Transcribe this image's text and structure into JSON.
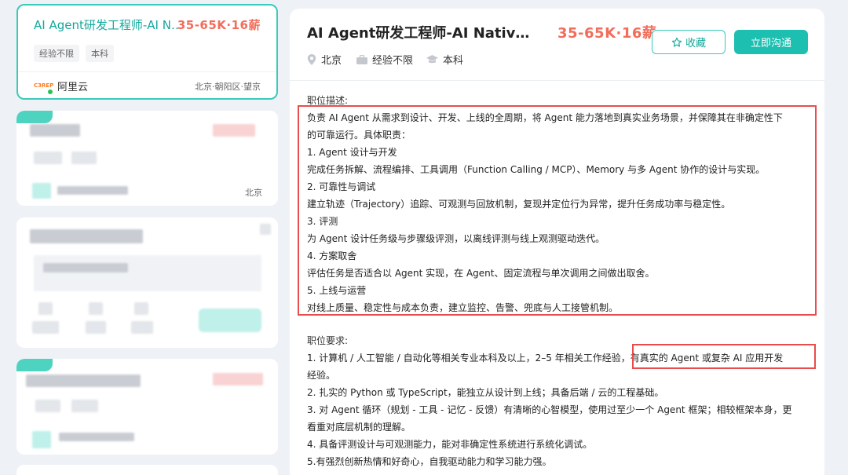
{
  "job_list": {
    "active_card": {
      "title": "AI Agent研发工程师-AI Native创新",
      "salary": "35-65K·16薪",
      "tags": [
        "经验不限",
        "本科"
      ],
      "company_logo_text": "C3REP",
      "company": "阿里云",
      "location": "北京·朝阳区·望京"
    },
    "card2": {
      "location": "北京"
    }
  },
  "detail": {
    "title": "AI Agent研发工程师-AI Native创新",
    "salary": "35-65K·16薪",
    "favorite_label": "收藏",
    "chat_label": "立即沟通",
    "meta": {
      "city": "北京",
      "experience": "经验不限",
      "education": "本科"
    },
    "description_heading": "职位描述:",
    "description_lines": [
      "负责 AI Agent 从需求到设计、开发、上线的全周期，将 Agent 能力落地到真实业务场景，并保障其在非确定性下",
      "的可靠运行。具体职责：",
      "1. Agent 设计与开发",
      "完成任务拆解、流程编排、工具调用（Function Calling / MCP）、Memory 与多 Agent 协作的设计与实现。",
      "2. 可靠性与调试",
      "建立轨迹（Trajectory）追踪、可观测与回放机制，复现并定位行为异常，提升任务成功率与稳定性。",
      "3. 评测",
      "为 Agent 设计任务级与步骤级评测，以离线评测与线上观测驱动迭代。",
      "4. 方案取舍",
      "评估任务是否适合以 Agent 实现，在 Agent、固定流程与单次调用之间做出取舍。",
      "5. 上线与运营",
      "对线上质量、稳定性与成本负责，建立监控、告警、兜底与人工接管机制。"
    ],
    "requirements_heading": "职位要求:",
    "requirement_lines": [
      "1. 计算机 / 人工智能 / 自动化等相关专业本科及以上，2–5 年相关工作经验，有真实的 Agent 或复杂 AI 应用开发",
      "经验。",
      "2. 扎实的 Python 或 TypeScript，能独立从设计到上线；具备后端 / 云的工程基础。",
      "3. 对 Agent 循环（规划 - 工具 - 记忆 - 反馈）有清晰的心智模型，使用过至少一个 Agent 框架；相较框架本身，更",
      "看重对底层机制的理解。",
      "4. 具备评测设计与可观测能力，能对非确定性系统进行系统化调试。",
      "5.有强烈创新热情和好奇心，自我驱动能力和学习能力强。"
    ]
  },
  "colors": {
    "accent": "#14a89c",
    "salary": "#f26d5b",
    "highlight_box": "#e84c4c"
  },
  "icons": [
    "location-icon",
    "briefcase-icon",
    "graduation-cap-icon",
    "star-icon"
  ]
}
